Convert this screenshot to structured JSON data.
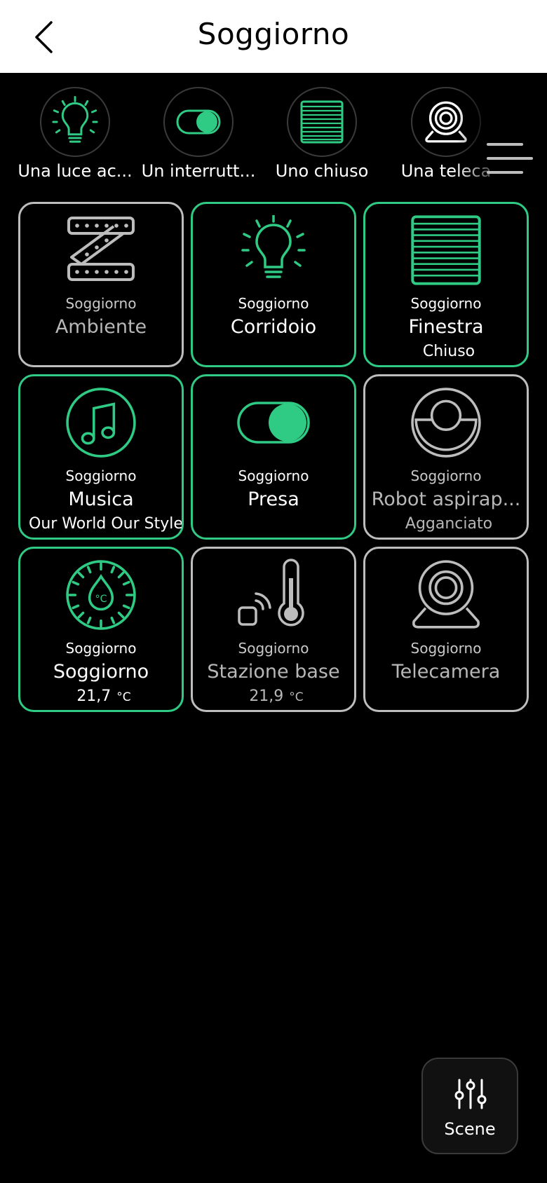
{
  "header": {
    "title": "Soggiorno"
  },
  "summary": [
    {
      "label": "Una luce ac...",
      "icon": "bulb-icon"
    },
    {
      "label": "Un interrutt...",
      "icon": "toggle-icon"
    },
    {
      "label": "Uno chiuso",
      "icon": "blind-icon"
    },
    {
      "label": "Una teleca",
      "icon": "camera-icon"
    }
  ],
  "tiles": [
    {
      "room": "Soggiorno",
      "name": "Ambiente",
      "status": "",
      "on": false,
      "icon": "led-strip-icon"
    },
    {
      "room": "Soggiorno",
      "name": "Corridoio",
      "status": "",
      "on": true,
      "icon": "bulb-icon"
    },
    {
      "room": "Soggiorno",
      "name": "Finestra",
      "status": "Chiuso",
      "on": true,
      "icon": "blind-icon"
    },
    {
      "room": "Soggiorno",
      "name": "Musica",
      "status": "Our World Our Style",
      "on": true,
      "icon": "music-note-icon"
    },
    {
      "room": "Soggiorno",
      "name": "Presa",
      "status": "",
      "on": true,
      "icon": "toggle-icon"
    },
    {
      "room": "Soggiorno",
      "name": "Robot aspirap...",
      "status": "Agganciato",
      "on": false,
      "icon": "robot-vacuum-icon"
    },
    {
      "room": "Soggiorno",
      "name": "Soggiorno",
      "status": "21,7",
      "unit": "°C",
      "on": true,
      "icon": "thermostat-icon"
    },
    {
      "room": "Soggiorno",
      "name": "Stazione base",
      "status": "21,9",
      "unit": "°C",
      "on": false,
      "icon": "thermometer-icon"
    },
    {
      "room": "Soggiorno",
      "name": "Telecamera",
      "status": "",
      "on": false,
      "icon": "camera-icon"
    }
  ],
  "scene_button": {
    "label": "Scene",
    "icon": "sliders-icon"
  },
  "colors": {
    "accent": "#2fcb84",
    "inactive": "#bdbdbd",
    "background": "#000000"
  }
}
